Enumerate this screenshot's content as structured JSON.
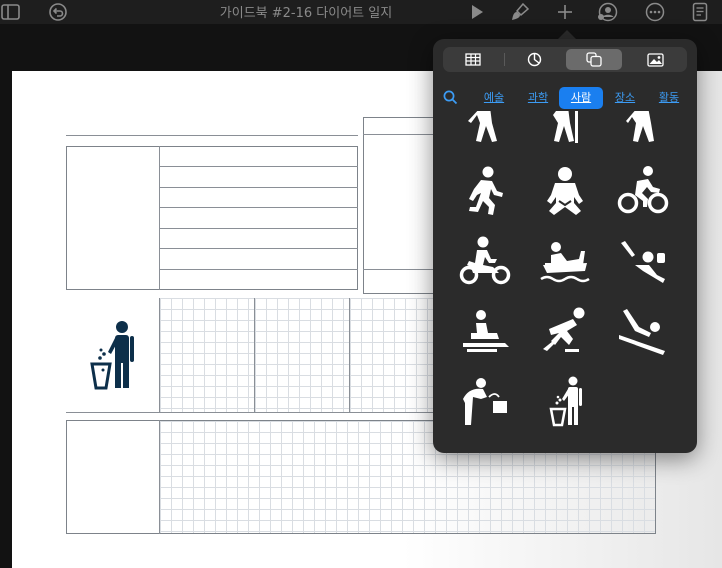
{
  "toolbar": {
    "document_title": "가이드북 #2-16 다이어트 일지",
    "left_icons": [
      "sidebar-icon",
      "undo-icon"
    ],
    "right_icons": [
      "play-icon",
      "paintbrush-icon",
      "plus-icon",
      "collaborate-icon",
      "more-icon",
      "document-icon"
    ]
  },
  "shapes_popover": {
    "tabs": [
      {
        "icon": "table-icon"
      },
      {
        "icon": "chart-icon"
      },
      {
        "icon": "shapes-icon",
        "selected": true
      },
      {
        "icon": "media-icon"
      }
    ],
    "categories": [
      "예술",
      "과학",
      "사람",
      "장소",
      "활동"
    ],
    "selected_category": "사람",
    "shapes": [
      "walking-person-icon",
      "hiking-person-icon",
      "walking-person-2-icon",
      "running-person-icon",
      "baby-icon",
      "cyclist-icon",
      "motorcyclist-icon",
      "rafting-icon",
      "snorkeler-icon",
      "snowmobile-icon",
      "skater-icon",
      "sledding-icon",
      "drinking-fountain-icon",
      "person-littering-icon"
    ]
  },
  "page_shapes": {
    "inserted_icon": "person-littering-icon",
    "icon_color": "#0d2f4a"
  },
  "colors": {
    "accent": "#1a7ff0",
    "link": "#3c9cf5",
    "popover_bg": "#2b2b2b"
  }
}
